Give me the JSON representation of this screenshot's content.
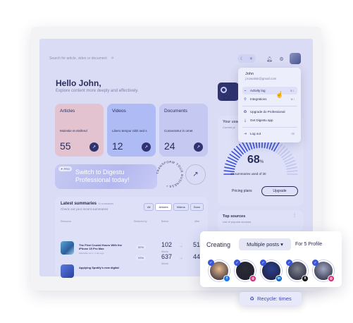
{
  "header": {
    "search_placeholder": "Search for article, video or document",
    "search_icon": "search-icon",
    "theme_icons": [
      "moon-icon",
      "sun-icon"
    ],
    "bell_icon": "bell-icon",
    "settings_icon": "gear-icon"
  },
  "greeting": {
    "title": "Hello John,",
    "subtitle": "Explore content more deeply and effectively."
  },
  "cards": [
    {
      "label": "Articles",
      "desc": "Molestie et eleifend",
      "count": "55",
      "color": "#e3c3cf"
    },
    {
      "label": "Videos",
      "desc": "Libero tempor nibh sed s",
      "count": "12",
      "color": "#aebbf4"
    },
    {
      "label": "Documents",
      "desc": "Consectetur in ornet",
      "count": "24",
      "color": "#c5c8f0"
    }
  ],
  "promo": {
    "badge": "✦ PRO",
    "text": "Switch to Digestu Professional today!",
    "ring_text": "TRANSFORM YOUR BUSINESS"
  },
  "latest": {
    "title": "Latest summaries",
    "count": "10 summaries",
    "subtitle": "Check out your recent summaries",
    "filters": [
      "All",
      "Articles",
      "Videos",
      "Docs"
    ],
    "columns": [
      "Resource",
      "Reduced by",
      "Before",
      "After"
    ],
    "rows": [
      {
        "title": "The First Crucial Hours With the iPhone 15 Pro Max",
        "meta": "Mashable.com  •  1 day ago",
        "pct": "52%",
        "before": "102",
        "before_unit": "Words",
        "after": "51"
      },
      {
        "title": "Applying Spotify's new digital",
        "meta": "",
        "pct": "93%",
        "before": "637",
        "before_unit": "Words",
        "after": "44"
      }
    ]
  },
  "menu": {
    "name": "John",
    "email": "j.kowalski@gmail.com",
    "items": [
      {
        "label": "Activity log",
        "icon": "activity-icon",
        "key": "⌘ L"
      },
      {
        "label": "Integrations",
        "icon": "plug-icon",
        "key": "⌘ I"
      },
      {
        "label": "Upgrade do Professional",
        "icon": "star-icon",
        "key": ""
      },
      {
        "label": "Get Digestu app",
        "icon": "download-icon",
        "key": ""
      },
      {
        "label": "Log out",
        "icon": "logout-icon",
        "key": "⌫"
      }
    ]
  },
  "usage": {
    "title": "Your usage",
    "subtitle": "Current pl",
    "percent": "68",
    "percent_sign": "%",
    "percent_value": 68,
    "used": "19 summaries used of 30",
    "plans": "Pricing plans",
    "upgrade": "Upgrade"
  },
  "top_sources": {
    "title": "Top sources",
    "subtitle": "List of popular sources"
  },
  "creating": {
    "label": "Creating",
    "select": "Multiple posts",
    "profile": "For 5 Profile",
    "avatars": [
      {
        "network": "f",
        "net_color": "#1877f2",
        "bg": "#e9b98c"
      },
      {
        "network": "◎",
        "net_color": "#d62976",
        "bg": "#2b2b34"
      },
      {
        "network": "in",
        "net_color": "#0a66c2",
        "bg": "#2c3f8e"
      },
      {
        "network": "X",
        "net_color": "#111111",
        "bg": "#7f8390"
      },
      {
        "network": "◎",
        "net_color": "#d62976",
        "bg": "#a4a9c4"
      }
    ]
  },
  "recycle": {
    "label": "Recycle: times",
    "icon": "recycle-icon"
  }
}
